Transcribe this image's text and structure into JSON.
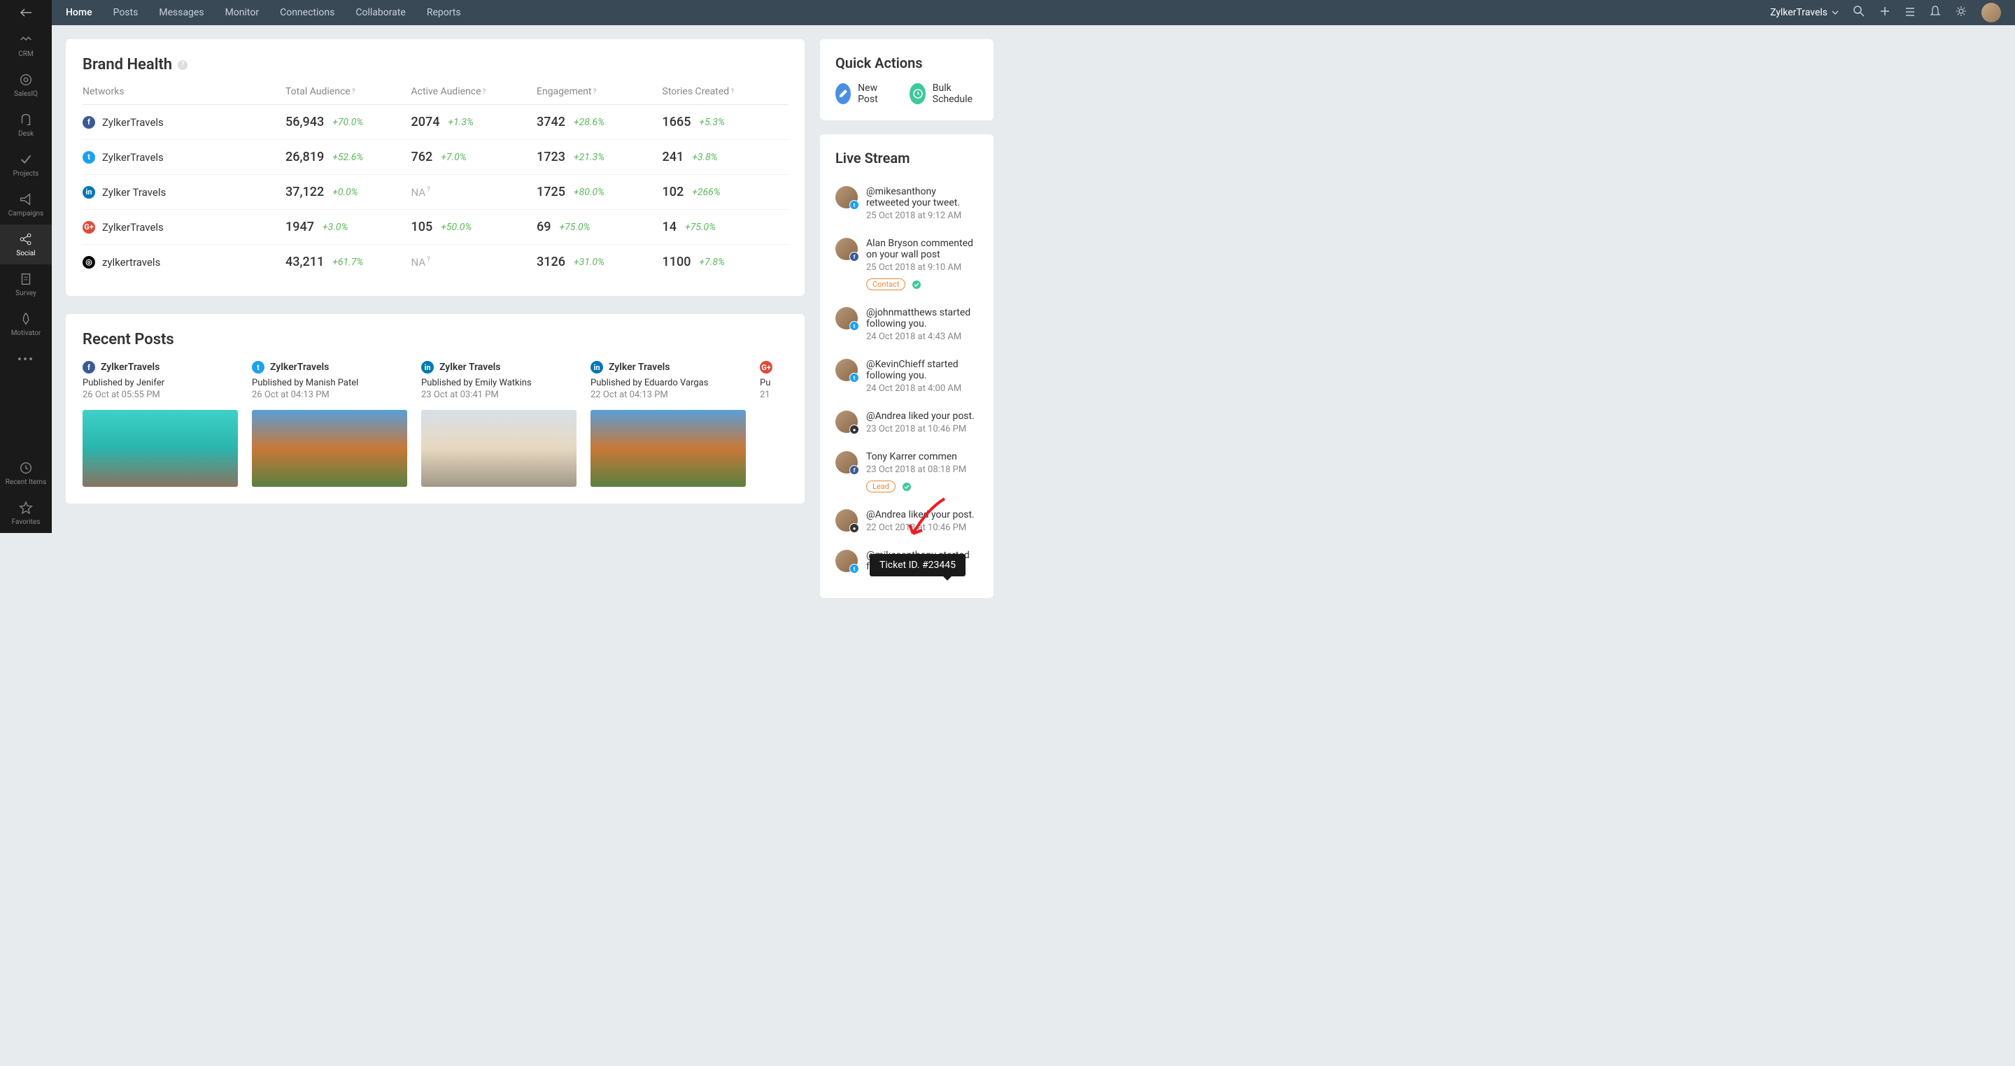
{
  "sidebar": {
    "items": [
      {
        "label": "CRM",
        "icon": "handshake"
      },
      {
        "label": "SalesIQ",
        "icon": "target"
      },
      {
        "label": "Desk",
        "icon": "headset"
      },
      {
        "label": "Projects",
        "icon": "check"
      },
      {
        "label": "Campaigns",
        "icon": "megaphone"
      },
      {
        "label": "Social",
        "icon": "share",
        "active": true
      },
      {
        "label": "Survey",
        "icon": "clipboard"
      },
      {
        "label": "Motivator",
        "icon": "rocket"
      }
    ],
    "recent": "Recent Items",
    "favorites": "Favorites"
  },
  "topbar": {
    "nav": [
      "Home",
      "Posts",
      "Messages",
      "Monitor",
      "Connections",
      "Collaborate",
      "Reports"
    ],
    "active": "Home",
    "account": "ZylkerTravels"
  },
  "brand_health": {
    "title": "Brand Health",
    "columns": [
      "Networks",
      "Total Audience",
      "Active Audience",
      "Engagement",
      "Stories Created"
    ],
    "rows": [
      {
        "net": "facebook",
        "name": "ZylkerTravels",
        "total": "56,943",
        "total_pct": "+70.0%",
        "active": "2074",
        "active_pct": "+1.3%",
        "eng": "3742",
        "eng_pct": "+28.6%",
        "stories": "1665",
        "stories_pct": "+5.3%"
      },
      {
        "net": "twitter",
        "name": "ZylkerTravels",
        "total": "26,819",
        "total_pct": "+52.6%",
        "active": "762",
        "active_pct": "+7.0%",
        "eng": "1723",
        "eng_pct": "+21.3%",
        "stories": "241",
        "stories_pct": "+3.8%"
      },
      {
        "net": "linkedin",
        "name": "Zylker Travels",
        "total": "37,122",
        "total_pct": "+0.0%",
        "active": "NA",
        "active_pct": "",
        "eng": "1725",
        "eng_pct": "+80.0%",
        "stories": "102",
        "stories_pct": "+266%"
      },
      {
        "net": "gplus",
        "name": "ZylkerTravels",
        "total": "1947",
        "total_pct": "+3.0%",
        "active": "105",
        "active_pct": "+50.0%",
        "eng": "69",
        "eng_pct": "+75.0%",
        "stories": "14",
        "stories_pct": "+75.0%"
      },
      {
        "net": "instagram",
        "name": "zylkertravels",
        "total": "43,211",
        "total_pct": "+61.7%",
        "active": "NA",
        "active_pct": "",
        "eng": "3126",
        "eng_pct": "+31.0%",
        "stories": "1100",
        "stories_pct": "+7.8%"
      }
    ]
  },
  "recent_posts": {
    "title": "Recent Posts",
    "posts": [
      {
        "net": "facebook",
        "name": "ZylkerTravels",
        "author": "Published by Jenifer",
        "date": "26 Oct at 05:55 PM",
        "img": "beach"
      },
      {
        "net": "twitter",
        "name": "ZylkerTravels",
        "author": "Published by Manish Patel",
        "date": "26 Oct at 04:13 PM",
        "img": "mountains"
      },
      {
        "net": "linkedin",
        "name": "Zylker Travels",
        "author": "Published by Emily Watkins",
        "date": "23 Oct at 03:41 PM",
        "img": "taj"
      },
      {
        "net": "linkedin",
        "name": "Zylker Travels",
        "author": "Published by Eduardo Vargas",
        "date": "22 Oct at 04:13 PM",
        "img": "mountains"
      },
      {
        "net": "gplus",
        "name": "",
        "author": "Pu",
        "date": "21",
        "img": ""
      }
    ]
  },
  "quick_actions": {
    "title": "Quick Actions",
    "new_post": "New Post",
    "bulk": "Bulk Schedule"
  },
  "live_stream": {
    "title": "Live Stream",
    "items": [
      {
        "text": "@mikesanthony retweeted your tweet.",
        "date": "25 Oct 2018 at 9:12 AM",
        "badge": "tw"
      },
      {
        "text": "Alan Bryson commented on your wall post",
        "date": "25 Oct 2018 at 9:10 AM",
        "badge": "fb",
        "tag": "Contact"
      },
      {
        "text": "@johnmatthews started following you.",
        "date": "24 Oct 2018 at 4:43 AM",
        "badge": "tw"
      },
      {
        "text": "@KevinChieff started following you.",
        "date": "24 Oct 2018 at 4:00 AM",
        "badge": "tw"
      },
      {
        "text": "@Andrea liked your post.",
        "date": "23 Oct 2018 at 10:46 PM",
        "badge": "ig"
      },
      {
        "text": "Tony Karrer commen",
        "date": "23 Oct 2018 at 08:18 PM",
        "badge": "fb",
        "tag": "Lead"
      },
      {
        "text": "@Andrea liked your post.",
        "date": "22 Oct 2018 at 10:46 PM",
        "badge": "ig"
      },
      {
        "text": "@mikesanthony started following you.",
        "date": "",
        "badge": "tw"
      }
    ]
  },
  "tooltip": "Ticket ID. #23445"
}
